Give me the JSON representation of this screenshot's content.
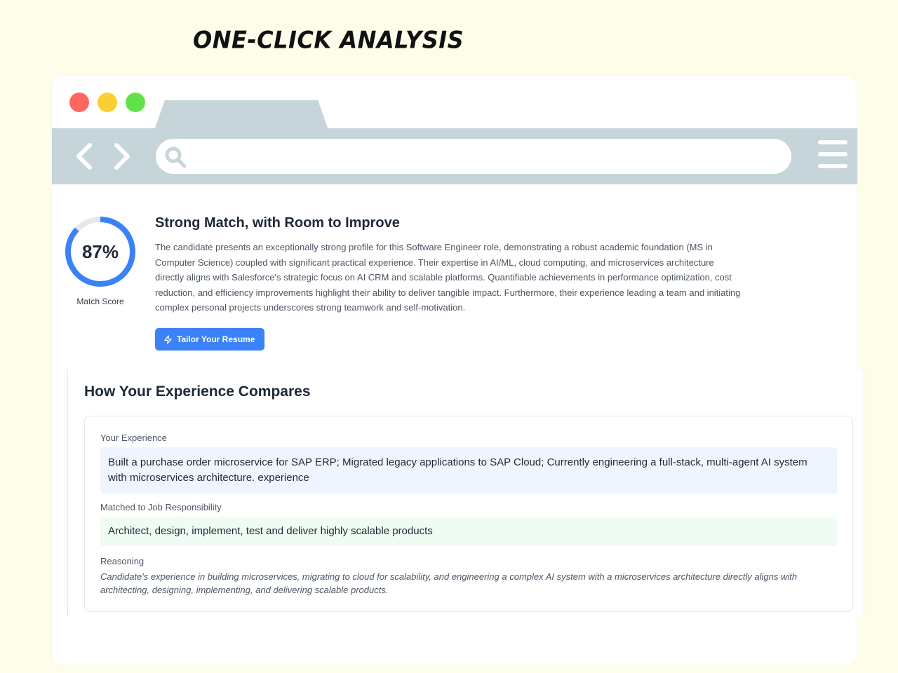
{
  "headline": "ONE-CLICK ANALYSIS",
  "browser": {
    "search_value": "",
    "colors": {
      "chrome": "#c6d5da",
      "close": "#fc6661",
      "minimize": "#fdce31",
      "maximize": "#63e14a"
    }
  },
  "match": {
    "score_text": "87%",
    "score_fraction": 0.87,
    "score_label": "Match Score",
    "title": "Strong Match, with Room to Improve",
    "description": "The candidate presents an exceptionally strong profile for this Software Engineer role, demonstrating a robust academic foundation (MS in Computer Science) coupled with significant practical experience. Their expertise in AI/ML, cloud computing, and microservices architecture directly aligns with Salesforce's strategic focus on AI CRM and scalable platforms. Quantifiable achievements in performance optimization, cost reduction, and efficiency improvements highlight their ability to deliver tangible impact. Furthermore, their experience leading a team and initiating complex personal projects underscores strong teamwork and self-motivation.",
    "tailor_button": "Tailor Your Resume",
    "accent": "#3b82f6"
  },
  "compare": {
    "title": "How Your Experience Compares",
    "your_experience_label": "Your Experience",
    "your_experience": "Built a purchase order microservice for SAP ERP; Migrated legacy applications to SAP Cloud; Currently engineering a full-stack, multi-agent AI system with microservices architecture. experience",
    "job_label": "Matched to Job Responsibility",
    "job_responsibility": "Architect, design, implement, test and deliver highly scalable products",
    "reasoning_label": "Reasoning",
    "reasoning": "Candidate's experience in building microservices, migrating to cloud for scalability, and engineering a complex AI system with a microservices architecture directly aligns with architecting, designing, implementing, and delivering scalable products."
  }
}
